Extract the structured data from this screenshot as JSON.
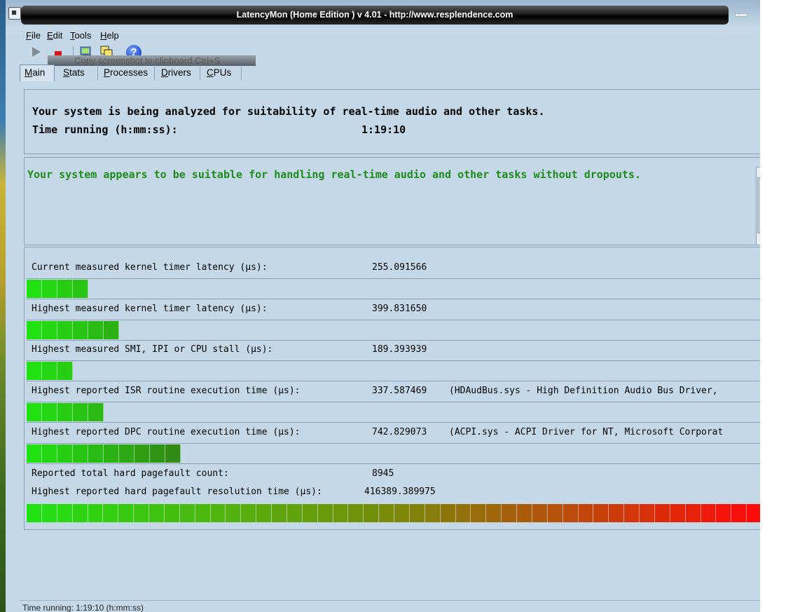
{
  "window": {
    "title": "LatencyMon  (Home Edition )  v 4.01 - http://www.resplendence.com"
  },
  "menu": [
    {
      "accel": "F",
      "rest": "ile"
    },
    {
      "accel": "E",
      "rest": "dit"
    },
    {
      "accel": "T",
      "rest": "ools"
    },
    {
      "accel": "H",
      "rest": "elp"
    }
  ],
  "toolbar": {
    "tooltip": "Copy screenshot to clipboard Ctrl+S",
    "icons": [
      "play-icon",
      "stop-icon",
      "computer-icon",
      "copy-screenshot-icon",
      "help-icon"
    ]
  },
  "tabs": [
    {
      "accel": "M",
      "rest": "ain"
    },
    {
      "accel": "S",
      "rest": "tats"
    },
    {
      "accel": "P",
      "rest": "rocesses"
    },
    {
      "accel": "D",
      "rest": "rivers"
    },
    {
      "accel": "C",
      "rest": "PUs"
    }
  ],
  "status_panel": {
    "line1": "Your system is being analyzed for suitability of real-time audio and other tasks.",
    "time_label": "Time running (h:mm:ss):",
    "time_value": "1:19:10"
  },
  "verdict": {
    "text": "Your system appears to be suitable for handling real-time audio and other tasks without dropouts."
  },
  "metrics": [
    {
      "label": "Current measured kernel timer latency (µs):",
      "value": "255.091566",
      "detail": "",
      "fill_segments": 4
    },
    {
      "label": "Highest measured kernel timer latency (µs):",
      "value": "399.831650",
      "detail": "",
      "fill_segments": 6
    },
    {
      "label": "Highest measured SMI, IPI or CPU stall (µs):",
      "value": "189.393939",
      "detail": "",
      "fill_segments": 3
    },
    {
      "label": "Highest reported ISR routine execution time (µs):",
      "value": "337.587469",
      "detail": "(HDAudBus.sys - High Definition Audio Bus Driver,",
      "fill_segments": 5
    },
    {
      "label": "Highest reported DPC routine execution time (µs):",
      "value": "742.829073",
      "detail": "(ACPI.sys - ACPI Driver for NT, Microsoft Corporat",
      "fill_segments": 10
    }
  ],
  "pagefault": {
    "count_label": "Reported total hard pagefault count:",
    "count_value": "8945",
    "resolution_label": "Highest reported hard pagefault resolution time (µs):",
    "resolution_value": "416389.389975",
    "fill_segments": 48
  },
  "statusbar": {
    "text": "Time running: 1:19:10  (h:mm:ss)"
  },
  "colors": {
    "bar_start": "#22e012",
    "bar_mid": "#7a8a0a",
    "bar_end": "#ff0a0a",
    "verdict_green": "#1c8a1c"
  }
}
